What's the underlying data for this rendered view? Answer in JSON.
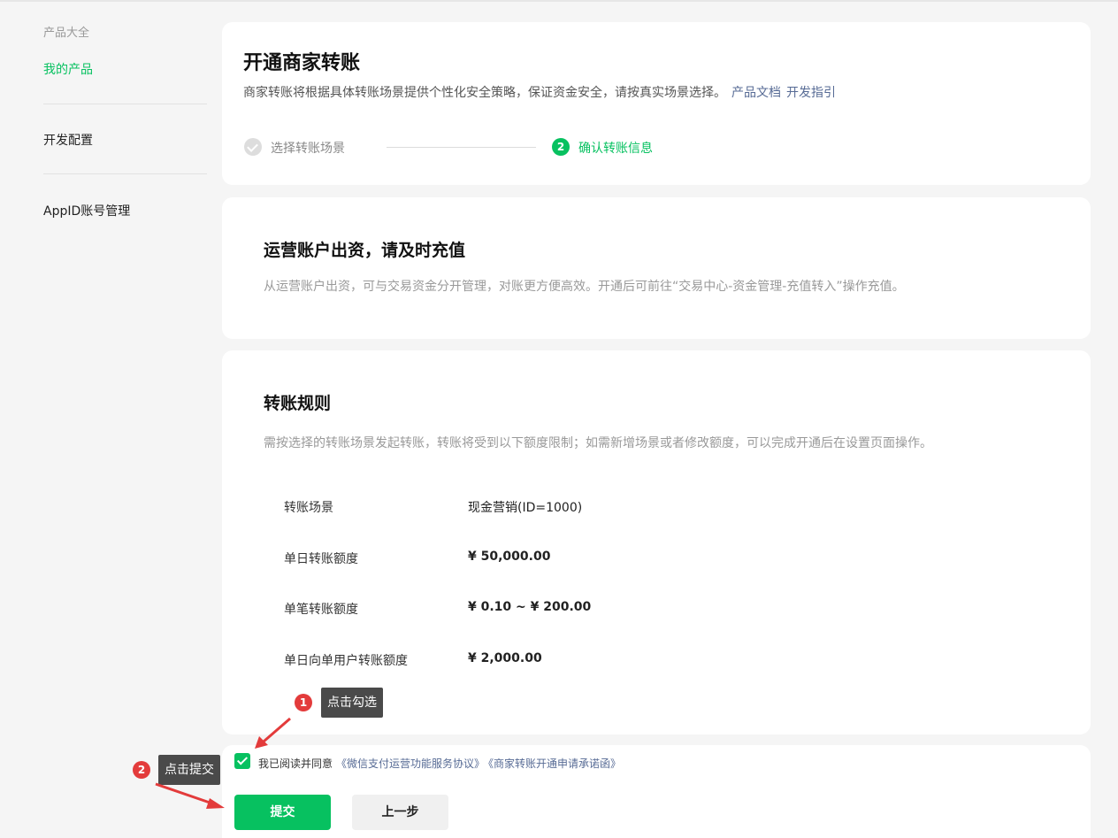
{
  "sidebar": {
    "category": "产品大全",
    "items": [
      {
        "label": "我的产品",
        "active": true
      },
      {
        "label": "开发配置",
        "active": false
      },
      {
        "label": "AppID账号管理",
        "active": false
      }
    ]
  },
  "header": {
    "title": "开通商家转账",
    "description": "商家转账将根据具体转账场景提供个性化安全策略，保证资金安全，请按真实场景选择。",
    "links": [
      "产品文档",
      "开发指引"
    ]
  },
  "steps": [
    {
      "number": "1",
      "label": "选择转账场景",
      "status": "done"
    },
    {
      "number": "2",
      "label": "确认转账信息",
      "status": "current"
    }
  ],
  "funding": {
    "title": "运营账户出资，请及时充值",
    "description": "从运营账户出资，可与交易资金分开管理，对账更方便高效。开通后可前往“交易中心-资金管理-充值转入”操作充值。"
  },
  "rules": {
    "title": "转账规则",
    "description": "需按选择的转账场景发起转账，转账将受到以下额度限制；如需新增场景或者修改额度，可以完成开通后在设置页面操作。",
    "rows": [
      {
        "label": "转账场景",
        "value": "现金营销(ID=1000)"
      },
      {
        "label": "单日转账额度",
        "value": "¥ 50,000.00"
      },
      {
        "label": "单笔转账额度",
        "value": "¥ 0.10 ~ ¥ 200.00"
      },
      {
        "label": "单日向单用户转账额度",
        "value": "¥ 2,000.00"
      }
    ]
  },
  "agreement": {
    "checked": true,
    "text": "我已阅读并同意",
    "links": [
      "《微信支付运营功能服务协议》",
      "《商家转账开通申请承诺函》"
    ]
  },
  "buttons": {
    "submit": "提交",
    "prev": "上一步"
  },
  "annotations": [
    {
      "number": "1",
      "text": "点击勾选"
    },
    {
      "number": "2",
      "text": "点击提交"
    }
  ],
  "colors": {
    "accent": "#07c160",
    "link": "#576b95",
    "annotation_badge": "#e33b3b",
    "tooltip_bg": "#4a4a4a"
  }
}
